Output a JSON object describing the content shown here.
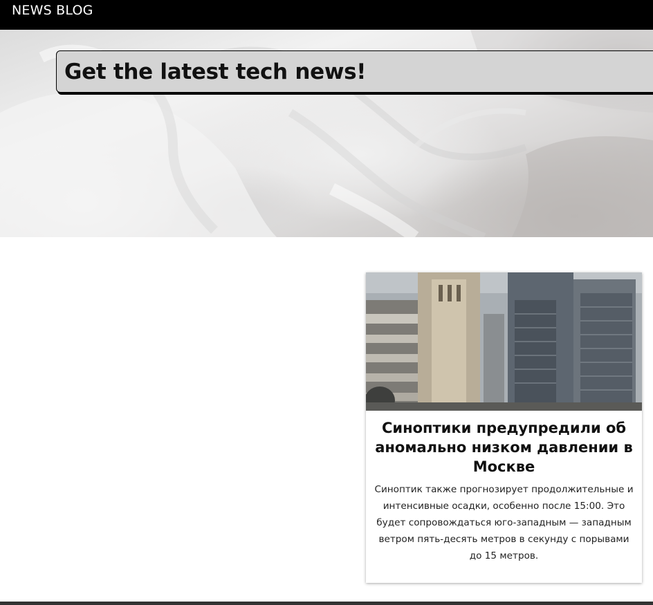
{
  "navbar": {
    "brand": "NEWS BLOG",
    "background": "#000000"
  },
  "hero": {
    "title": "Get the latest tech news!",
    "image_subject": "white-bedsheet-photo",
    "banner_color": "#d4d4d4"
  },
  "articles": [
    {
      "image_subject": "moscow-city-skyscrapers-photo",
      "title": "Синоптики предупредили об аномально низком давлении в Москве",
      "text": "Синоптик также прогнозирует продолжительные и интенсивные осадки, особенно после 15:00. Это будет сопровождаться юго-западным — западным ветром пять-десять метров в секунду с порывами до 15 метров."
    }
  ],
  "footer": {
    "color": "#333333"
  }
}
